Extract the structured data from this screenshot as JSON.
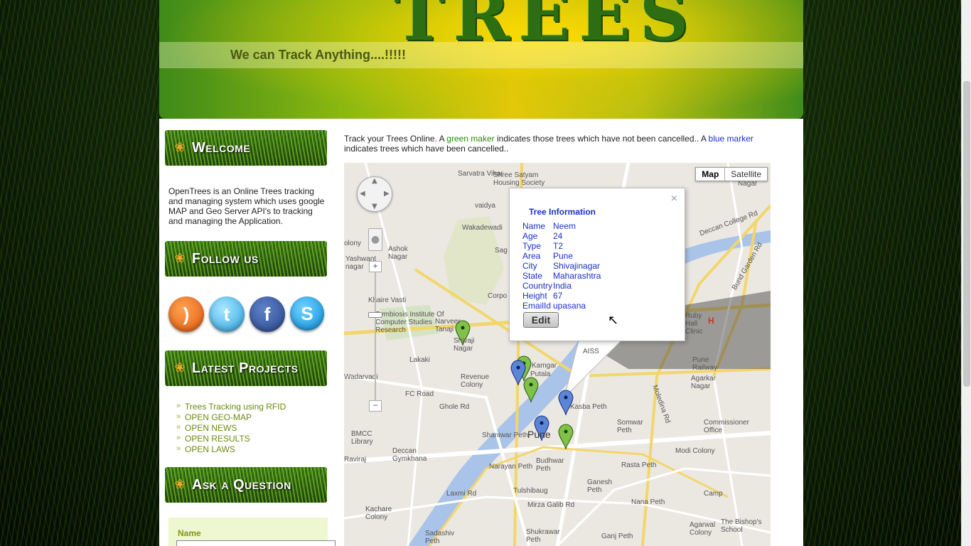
{
  "header": {
    "logo_text": "TREES",
    "tagline": "We can Track Anything....!!!!!"
  },
  "sidebar": {
    "welcome_title": "Welcome",
    "welcome_text": "OpenTrees is an Online Trees tracking and managing system which uses google MAP and Geo Server API's to tracking and managing the Application.",
    "follow_title": "Follow us",
    "social": [
      {
        "name": "rss-icon",
        "glyph": ")"
      },
      {
        "name": "twitter-icon",
        "glyph": "t"
      },
      {
        "name": "facebook-icon",
        "glyph": "f"
      },
      {
        "name": "skype-icon",
        "glyph": "S"
      }
    ],
    "projects_title": "Latest Projects",
    "projects": [
      "Trees Tracking using RFID",
      "OPEN GEO-MAP",
      "OPEN NEWS",
      "OPEN RESULTS",
      "OPEN LAWS"
    ],
    "ask_title": "Ask a Question",
    "ask_name_label": "Name"
  },
  "main": {
    "intro_before": "Track your Trees Online. A ",
    "intro_green": "green maker",
    "intro_middle": " indicates those trees which have not been cancelled.. A ",
    "intro_blue": "blue marker",
    "intro_after": " indicates trees which have been cancelled.."
  },
  "map": {
    "type_map": "Map",
    "type_satellite": "Satellite",
    "labels": [
      "Sarvatra Vihar",
      "Shree Satyam Housing Society",
      "vaidya",
      "Wakadewadi",
      "Ashok Nagar",
      "Yashwant nagar",
      "Khaire Vasti",
      "Symbiosis Institute Of Computer Studies Research",
      "Narveer Tanaji",
      "Shivaji Nagar",
      "Revenue Colony",
      "Lakaki",
      "Wadarvadi",
      "FC Road",
      "Ghole Rd",
      "Shaniwar Peth",
      "BMCC Library",
      "Deccan Gymkhana",
      "Raviraj",
      "Narayan Peth",
      "Tulshibaug",
      "Budhwar Peth",
      "Kasba Peth",
      "Somwar Peth",
      "Rasta Peth",
      "Modi Colony",
      "Ganesh Peth",
      "Nana Peth",
      "Mirza Galib Rd",
      "Laxmi Rd",
      "Kachare Colony",
      "Sadashiv Peth",
      "Shukrawar Peth",
      "Ganj Peth",
      "Agarkar Nagar",
      "Pune Railway",
      "Camp",
      "Commissioner Office",
      "Moledina Rd",
      "Bund Garden Rd",
      "Deccan College Rd",
      "Nagar",
      "Sag",
      "Corpo",
      "olony",
      "Putala",
      "Kamgar",
      "Ruby Hall Clinic",
      "AISS",
      "The Bishop's School",
      "Agarwal Colony"
    ],
    "city_label": "Pune"
  },
  "info_window": {
    "title": "Tree Information",
    "rows": [
      {
        "key": "Name",
        "value": "Neem"
      },
      {
        "key": "Age",
        "value": "24"
      },
      {
        "key": "Type",
        "value": "T2"
      },
      {
        "key": "Area",
        "value": "Pune"
      },
      {
        "key": "City",
        "value": "Shivajinagar"
      },
      {
        "key": "State",
        "value": "Maharashtra"
      },
      {
        "key": "Country",
        "value": "India"
      },
      {
        "key": "Height",
        "value": "67"
      },
      {
        "key": "EmailId",
        "value": "upasana"
      }
    ],
    "edit_label": "Edit",
    "close_glyph": "×"
  }
}
